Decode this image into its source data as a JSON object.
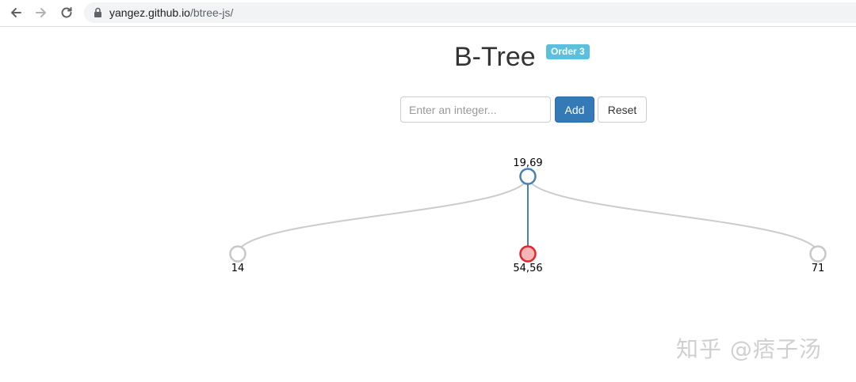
{
  "browser": {
    "url_host": "yangez.github.io",
    "url_path": "/btree-js/"
  },
  "header": {
    "title": "B-Tree",
    "badge": "Order 3"
  },
  "controls": {
    "input_placeholder": "Enter an integer...",
    "input_value": "",
    "add_label": "Add",
    "reset_label": "Reset"
  },
  "tree": {
    "root": {
      "label": "19,69",
      "children": [
        {
          "label": "14",
          "highlighted": false
        },
        {
          "label": "54,56",
          "highlighted": true
        },
        {
          "label": "71",
          "highlighted": false
        }
      ]
    }
  },
  "watermark": "知乎 @痞子汤",
  "colors": {
    "root_node_stroke": "#4682b4",
    "highlight_node_stroke": "#e8232a",
    "highlight_node_fill": "#f4b6b6",
    "leaf_node_stroke": "#c8c8c8",
    "active_link": "#4682b4",
    "link": "#cccccc",
    "badge": "#5bc0de",
    "primary_button": "#337ab7"
  },
  "icons": {
    "back": "arrow-left-icon",
    "forward": "arrow-right-icon",
    "reload": "reload-icon",
    "lock": "lock-icon"
  }
}
